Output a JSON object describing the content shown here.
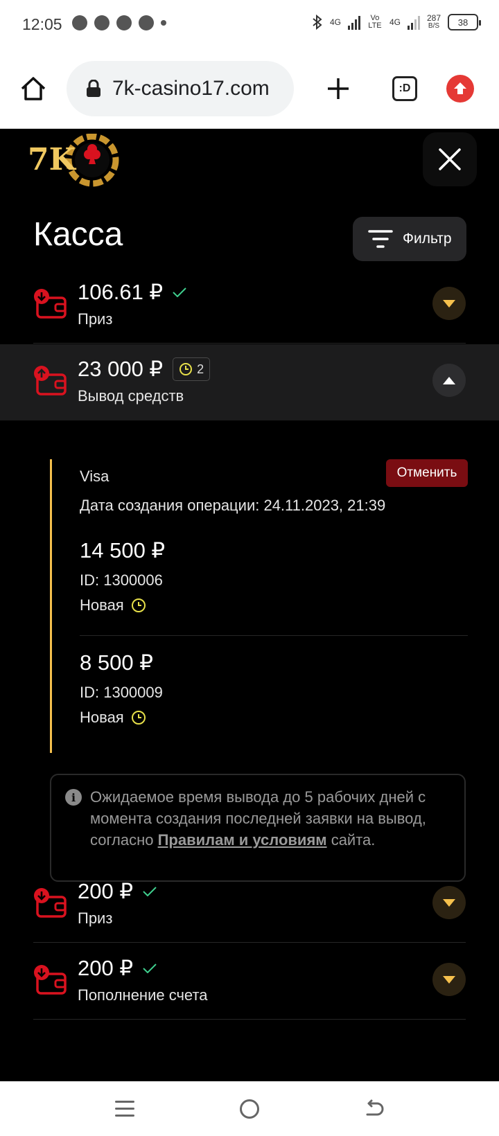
{
  "status_bar": {
    "time": "12:05",
    "network_speed_value": "287",
    "network_speed_unit": "B/S",
    "net_labels": [
      "4G",
      "Vo LTE",
      "4G"
    ],
    "battery": "38"
  },
  "browser": {
    "url": "7k-casino17.com",
    "tabs_label": ":D"
  },
  "header": {
    "logo_text": "7K",
    "title": "Касса",
    "filter_label": "Фильтр"
  },
  "transactions": [
    {
      "amount": "106.61 ₽",
      "label": "Приз",
      "status": "completed"
    },
    {
      "amount": "23 000 ₽",
      "label": "Вывод средств",
      "pending_count": "2",
      "status": "pending"
    },
    {
      "amount": "200 ₽",
      "label": "Приз",
      "status": "completed"
    },
    {
      "amount": "200 ₽",
      "label": "Пополнение счета",
      "status": "completed"
    }
  ],
  "detail": {
    "method": "Visa",
    "cancel_label": "Отменить",
    "created": "Дата создания операции: 24.11.2023, 21:39",
    "requests": [
      {
        "amount": "14 500 ₽",
        "id": "ID: 1300006",
        "status": "Новая"
      },
      {
        "amount": "8 500 ₽",
        "id": "ID: 1300009",
        "status": "Новая"
      }
    ]
  },
  "info": {
    "text_before": "Ожидаемое время вывода до 5 рабочих дней с момента создания последней заявки на вывод, согласно ",
    "link_text": "Правилам и условиям",
    "text_after": " сайта."
  },
  "colors": {
    "accent_gold": "#f5c04d",
    "wallet_red": "#d9121f",
    "check_green": "#3fcf8e",
    "cancel_bg": "#7a0d12"
  }
}
